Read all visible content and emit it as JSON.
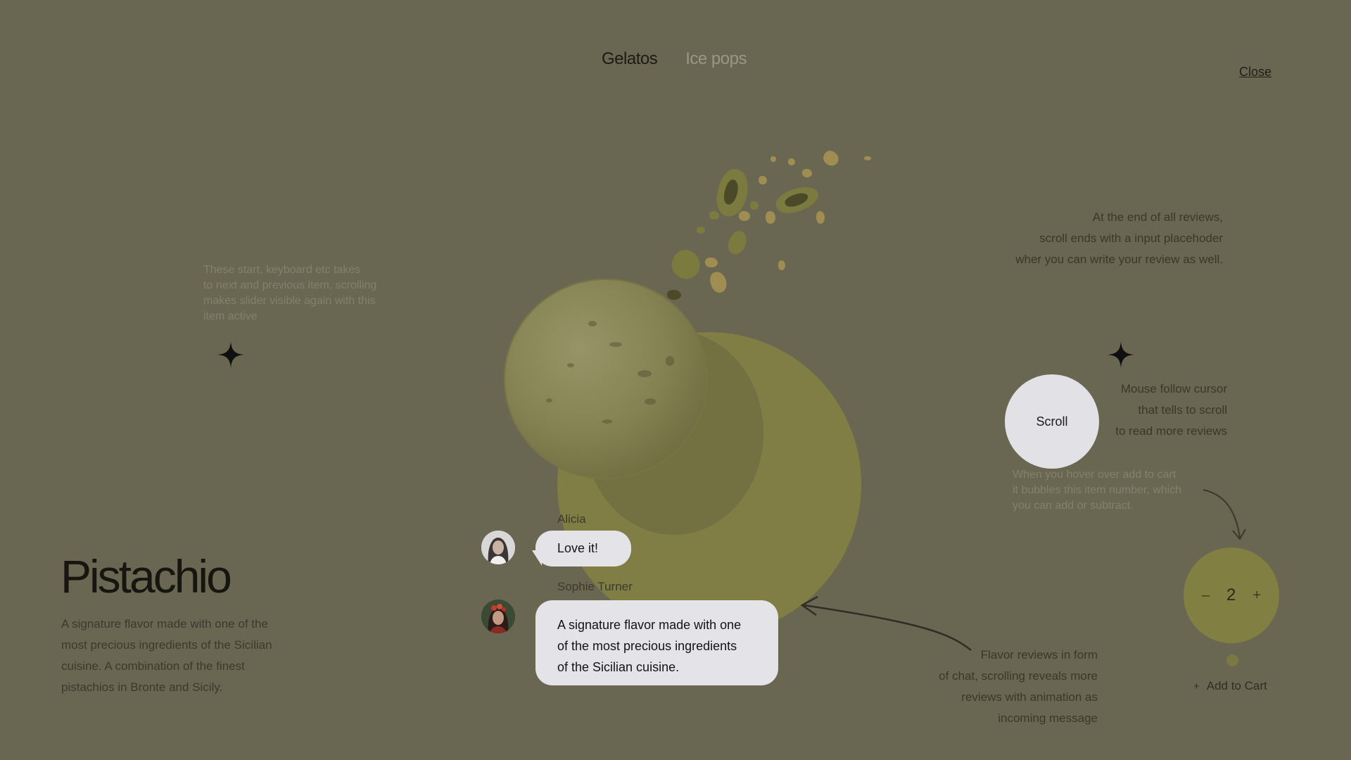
{
  "tabs": [
    {
      "label": "Gelatos",
      "active": true
    },
    {
      "label": "Ice pops",
      "active": false
    }
  ],
  "close_label": "Close",
  "notes": {
    "slider_note": [
      "These start, keyboard etc takes",
      "to next and previous item, scrolling",
      "makes slider visible again with this",
      "item active"
    ],
    "review_end_note": [
      "At the end of all reviews,",
      "scroll ends with a input placehoder",
      "wher you can write your review as well."
    ],
    "mouse_note": [
      "Mouse follow cursor",
      "that tells to scroll",
      "to read more reviews"
    ],
    "cart_hover_note": [
      "When you hover over add to cart",
      "it bubbles this item number, which",
      "you can add or subtract."
    ],
    "reviews_note": [
      "Flavor reviews in form",
      "of chat, scrolling reveals more",
      "reviews with animation as",
      "incoming message"
    ]
  },
  "scroll_label": "Scroll",
  "chat": [
    {
      "name": "Alicia",
      "message": "Love it!",
      "avatar": "woman-avatar-icon"
    },
    {
      "name": "Sophie Turner",
      "message_lines": [
        "A signature flavor made with one",
        "of the most precious ingredients",
        "of the Sicilian cuisine."
      ],
      "avatar": "woman-flowers-avatar-icon"
    }
  ],
  "product": {
    "title": "Pistachio",
    "description_lines": [
      "A signature flavor made with one of the",
      "most precious ingredients of the Sicilian",
      "cuisine. A combination of the finest",
      "pistachios in Bronte and Sicily."
    ]
  },
  "cart": {
    "minus": "–",
    "quantity": "2",
    "plus": "+",
    "add_icon": "+",
    "add_label": "Add to Cart"
  },
  "colors": {
    "background": "#696752",
    "accent_circle": "#807d45",
    "bubble": "#e4e3e7"
  }
}
